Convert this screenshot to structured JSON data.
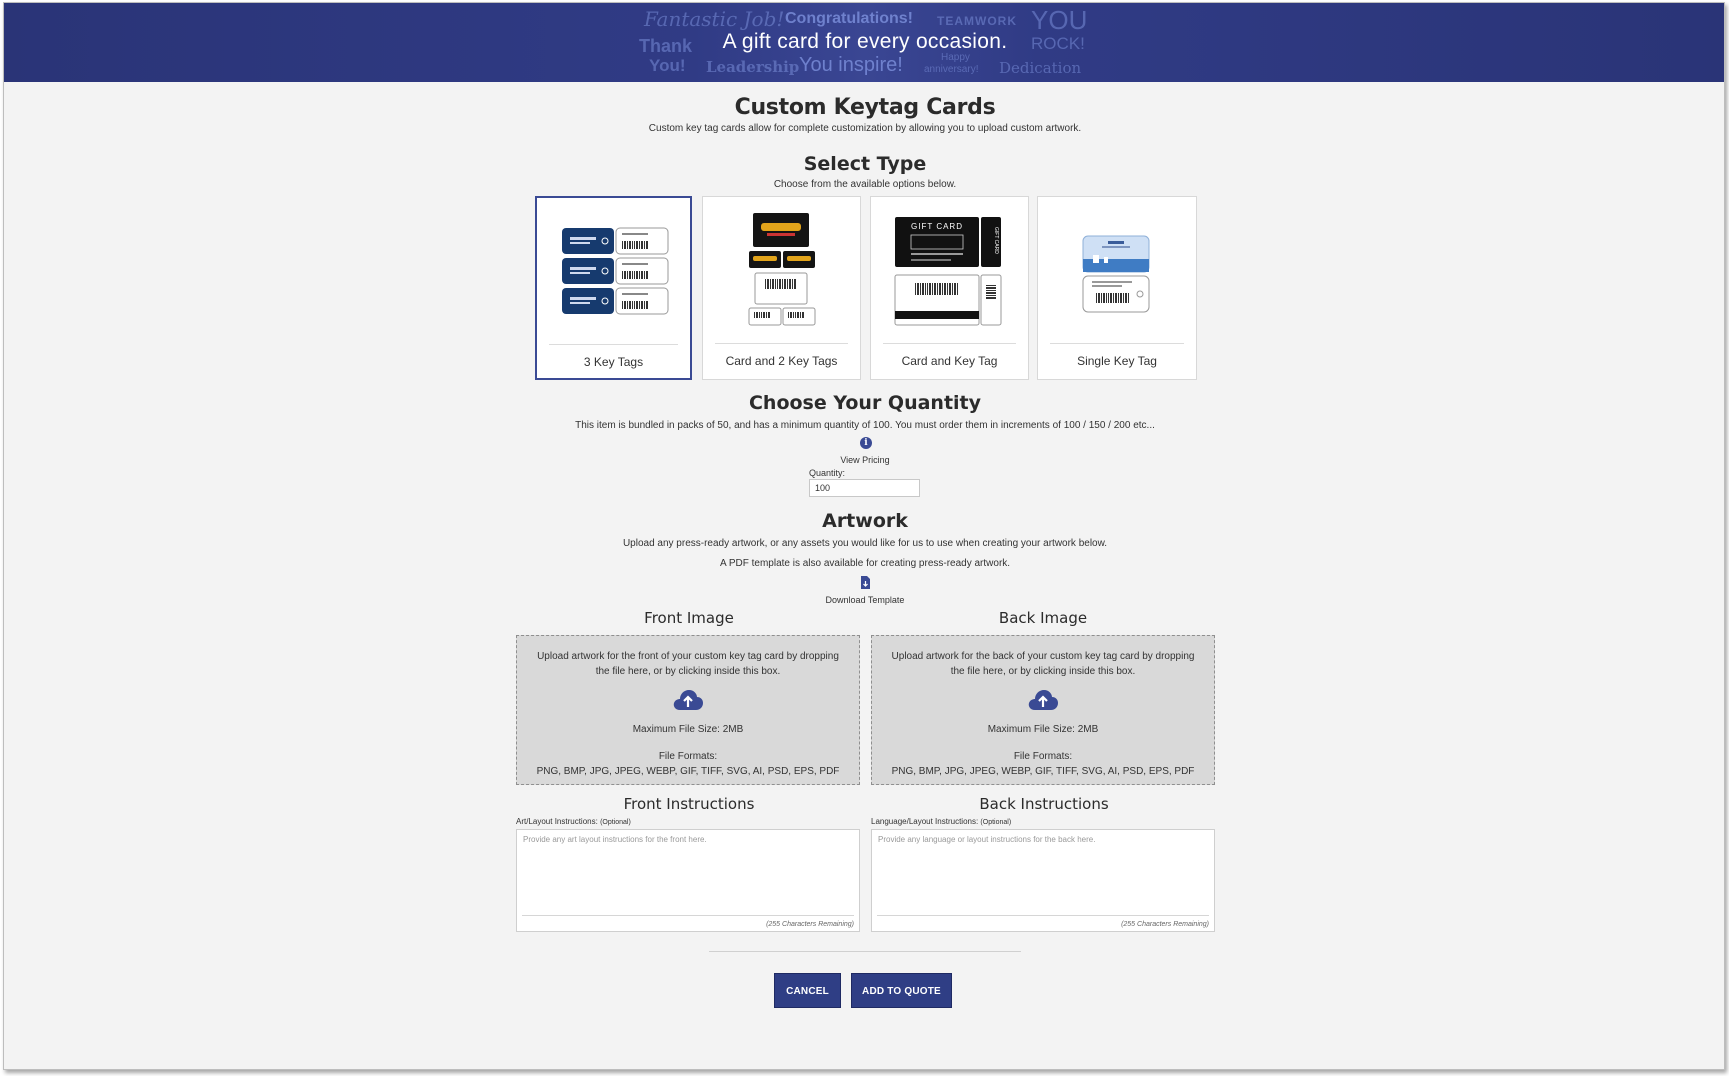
{
  "banner": {
    "headline": "A gift card for every occasion.",
    "words": [
      "Fantastic Job!",
      "Congratulations!",
      "TEAMWORK",
      "YOU",
      "ROCK!",
      "Thank",
      "You!",
      "Leadership",
      "You inspire!",
      "Happy",
      "anniversary!",
      "Dedication"
    ]
  },
  "page": {
    "title": "Custom Keytag Cards",
    "subtitle": "Custom key tag cards allow for complete customization by allowing you to upload custom artwork."
  },
  "select_type": {
    "heading": "Select Type",
    "description": "Choose from the available options below.",
    "options": [
      {
        "label": "3 Key Tags",
        "selected": true
      },
      {
        "label": "Card and 2 Key Tags",
        "selected": false
      },
      {
        "label": "Card and Key Tag",
        "selected": false
      },
      {
        "label": "Single Key Tag",
        "selected": false
      }
    ],
    "card_text": {
      "gift_card": "GIFT CARD",
      "gift_card_side": "GIFT CARD"
    }
  },
  "quantity": {
    "heading": "Choose Your Quantity",
    "description": "This item is bundled in packs of 50, and has a minimum quantity of 100. You must order them in increments of 100 / 150 / 200 etc...",
    "view_pricing": "View Pricing",
    "label": "Quantity:",
    "value": "100"
  },
  "artwork": {
    "heading": "Artwork",
    "description": "Upload any press-ready artwork, or any assets you would like for us to use when creating your artwork below.",
    "template_note": "A PDF template is also available for creating press-ready artwork.",
    "download_template": "Download Template",
    "front": {
      "heading": "Front Image",
      "text": "Upload artwork for the front of your custom key tag card by dropping the file here, or by clicking inside this box.",
      "max_size": "Maximum File Size: 2MB",
      "formats_label": "File Formats:",
      "formats": "PNG, BMP, JPG, JPEG, WEBP, GIF, TIFF, SVG, AI, PSD, EPS, PDF"
    },
    "back": {
      "heading": "Back Image",
      "text": "Upload artwork for the back of your custom key tag card by dropping the file here, or by clicking inside this box.",
      "max_size": "Maximum File Size: 2MB",
      "formats_label": "File Formats:",
      "formats": "PNG, BMP, JPG, JPEG, WEBP, GIF, TIFF, SVG, AI, PSD, EPS, PDF"
    }
  },
  "instructions": {
    "front": {
      "heading": "Front Instructions",
      "label": "Art/Layout Instructions:",
      "optional": "(Optional)",
      "placeholder": "Provide any art layout instructions for the front here.",
      "remaining": "(255 Characters Remaining)"
    },
    "back": {
      "heading": "Back Instructions",
      "label": "Language/Layout Instructions:",
      "optional": "(Optional)",
      "placeholder": "Provide any language or layout instructions for the back here.",
      "remaining": "(255 Characters Remaining)"
    }
  },
  "actions": {
    "cancel": "CANCEL",
    "add_to_quote": "ADD TO QUOTE"
  },
  "colors": {
    "banner": "#2a3477",
    "button": "#2f3e85",
    "selected_border": "#3a4a94",
    "icon": "#3a4a94"
  }
}
